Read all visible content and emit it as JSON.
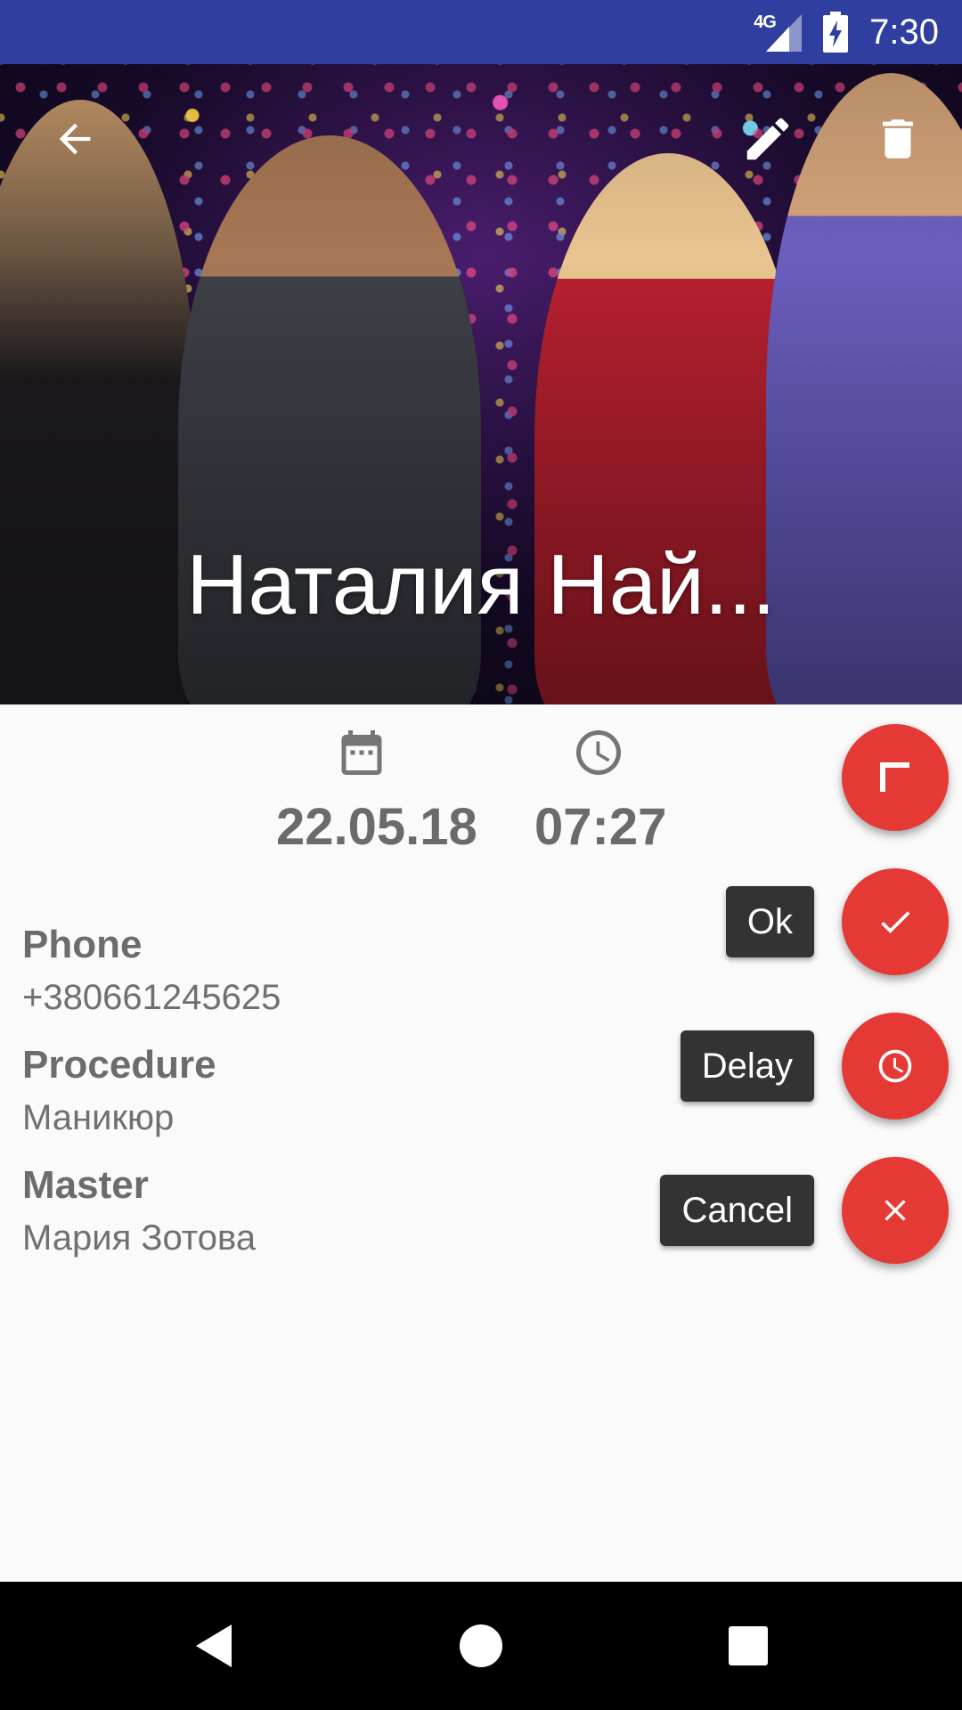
{
  "status_bar": {
    "network": "4G",
    "time": "7:30",
    "background": "#303f9f"
  },
  "header": {
    "title": "Наталия Най...",
    "back_icon": "arrow-back-icon",
    "edit_icon": "pencil-icon",
    "delete_icon": "trash-icon"
  },
  "appointment": {
    "date_icon": "calendar-icon",
    "date": "22.05.18",
    "time_icon": "clock-icon",
    "time": "07:27"
  },
  "details": {
    "phone_label": "Phone",
    "phone_value": "+380661245625",
    "procedure_label": "Procedure",
    "procedure_value": "Маникюр",
    "master_label": "Master",
    "master_value": "Мария Зотова"
  },
  "fab_menu": {
    "accent": "#e53935",
    "main_icon": "corner-icon",
    "ok_label": "Ok",
    "ok_icon": "check-icon",
    "delay_label": "Delay",
    "delay_icon": "clock-icon",
    "cancel_label": "Cancel",
    "cancel_icon": "close-icon"
  },
  "nav_bar": {
    "back_icon": "triangle-back-icon",
    "home_icon": "circle-home-icon",
    "recents_icon": "square-recents-icon"
  }
}
